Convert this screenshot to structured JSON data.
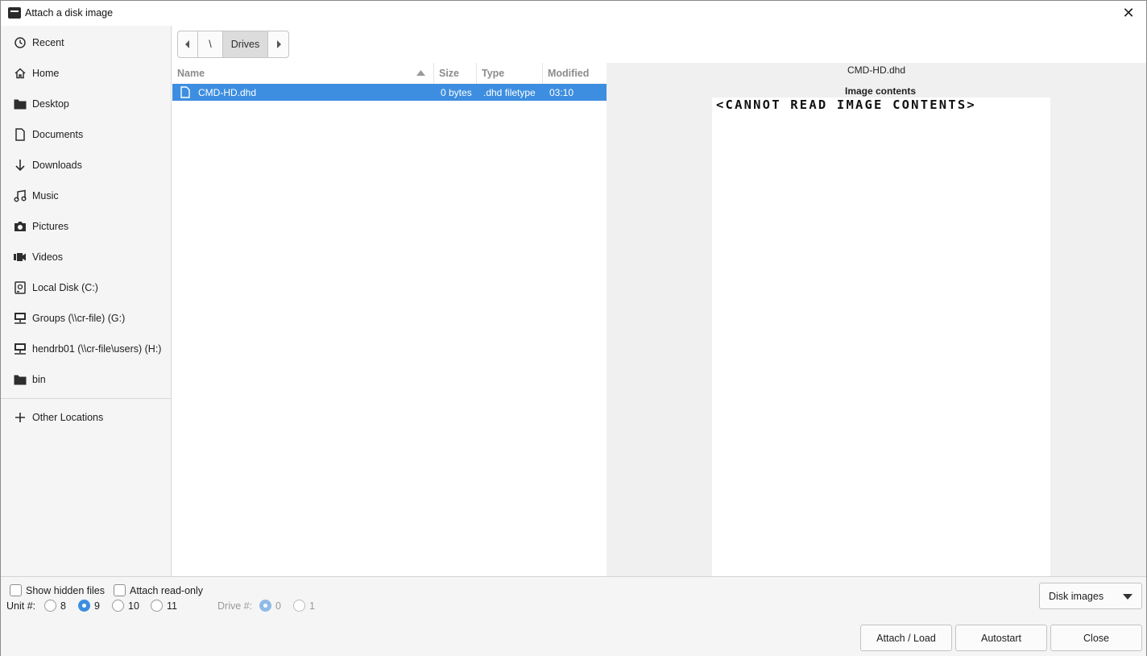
{
  "window": {
    "title": "Attach a disk image",
    "close_glyph": "✕"
  },
  "sidebar": {
    "items": [
      {
        "label": "Recent",
        "icon": "clock-icon"
      },
      {
        "label": "Home",
        "icon": "home-icon"
      },
      {
        "label": "Desktop",
        "icon": "folder-icon"
      },
      {
        "label": "Documents",
        "icon": "document-icon"
      },
      {
        "label": "Downloads",
        "icon": "download-icon"
      },
      {
        "label": "Music",
        "icon": "music-icon"
      },
      {
        "label": "Pictures",
        "icon": "camera-icon"
      },
      {
        "label": "Videos",
        "icon": "video-icon"
      },
      {
        "label": "Local Disk (C:)",
        "icon": "disk-icon"
      },
      {
        "label": "Groups (\\\\cr-file) (G:)",
        "icon": "network-drive-icon"
      },
      {
        "label": "hendrb01 (\\\\cr-file\\users) (H:)",
        "icon": "network-drive-icon"
      },
      {
        "label": "bin",
        "icon": "folder-icon"
      }
    ],
    "other_locations": "Other Locations"
  },
  "pathbar": {
    "root": "\\",
    "current": "Drives"
  },
  "filelist": {
    "columns": {
      "name": "Name",
      "size": "Size",
      "type": "Type",
      "modified": "Modified"
    },
    "rows": [
      {
        "name": "CMD-HD.dhd",
        "size": "0 bytes",
        "type": ".dhd filetype",
        "modified": "03:10",
        "selected": true
      }
    ]
  },
  "preview": {
    "filename": "CMD-HD.dhd",
    "label": "Image contents",
    "contents": "<CANNOT READ IMAGE CONTENTS>"
  },
  "options": {
    "show_hidden": {
      "label": "Show hidden files",
      "checked": false
    },
    "read_only": {
      "label": "Attach read-only",
      "checked": false
    },
    "unit_label": "Unit #:",
    "units": [
      "8",
      "9",
      "10",
      "11"
    ],
    "unit_selected": "9",
    "drive_label": "Drive #:",
    "drives": [
      "0",
      "1"
    ],
    "drive_selected": "0"
  },
  "filter": {
    "selected": "Disk images"
  },
  "buttons": {
    "attach": "Attach / Load",
    "autostart": "Autostart",
    "close": "Close"
  },
  "colors": {
    "accent": "#3d8ee0",
    "sidebar_bg": "#f5f5f5",
    "preview_bg": "#f0f0f0"
  }
}
